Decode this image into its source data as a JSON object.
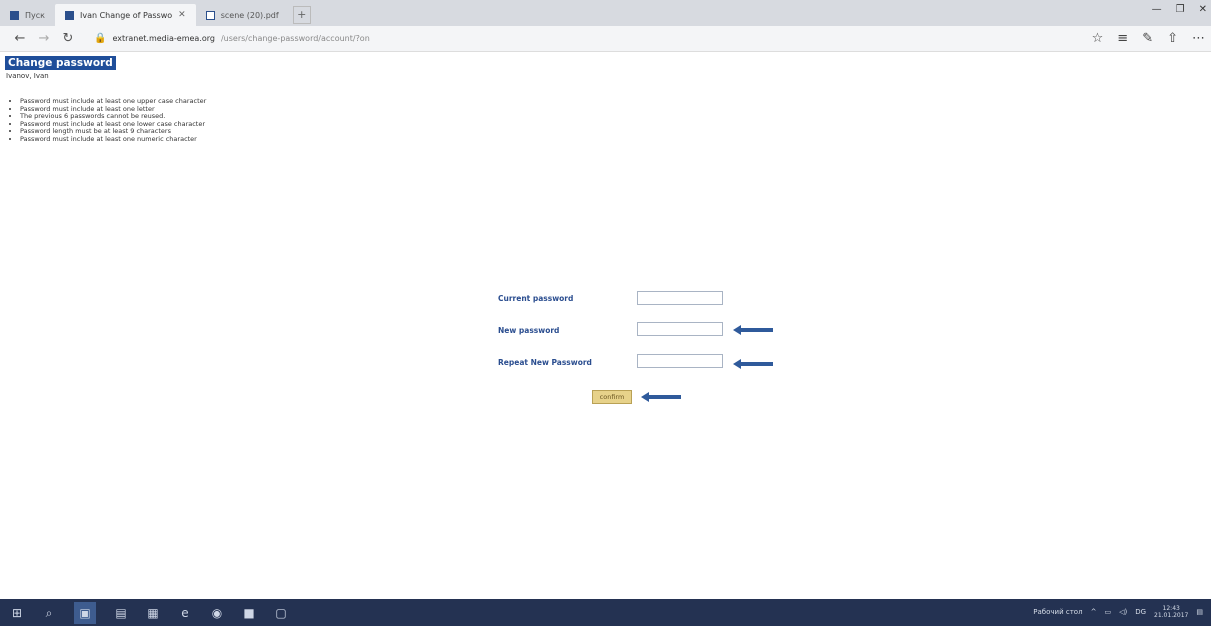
{
  "browser": {
    "tabs": [
      {
        "label": "Пуск",
        "active": false
      },
      {
        "label": "Ivan Change of Passwo",
        "active": true
      },
      {
        "label": "scene (20).pdf",
        "active": false
      }
    ],
    "address": {
      "host": "extranet.media-emea.org",
      "path": "/users/change-password/account/?on"
    }
  },
  "page": {
    "title": "Change password",
    "user_name": "Ivanov, Ivan",
    "rules": [
      "Password must include at least one upper case character",
      "Password must include at least one letter",
      "The previous 6 passwords cannot be reused.",
      "Password must include at least one lower case character",
      "Password length must be at least 9 characters",
      "Password must include at least one numeric character"
    ]
  },
  "form": {
    "current_label": "Current password",
    "new_label": "New password",
    "repeat_label": "Repeat New Password",
    "confirm_label": "confirm"
  },
  "taskbar": {
    "tray_text": "Рабочий стол",
    "lang": "DG",
    "time": "12:43",
    "date": "21.01.2017"
  },
  "colors": {
    "title_bg": "#1f4e9a",
    "label": "#2a4d8f",
    "arrow": "#2f5a9b",
    "taskbar": "#243252"
  }
}
